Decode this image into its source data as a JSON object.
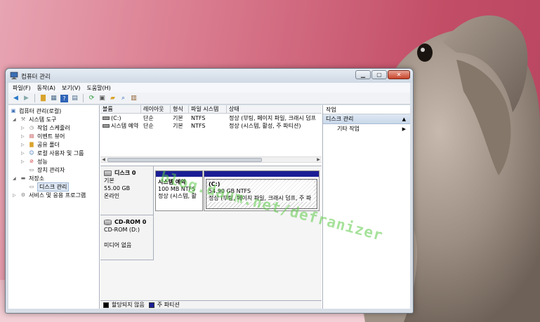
{
  "window": {
    "title": "컴퓨터 관리"
  },
  "menu": [
    "파일(F)",
    "동작(A)",
    "보기(V)",
    "도움말(H)"
  ],
  "toolbar_icons": [
    "back-arrow-icon",
    "forward-arrow-icon",
    "up-folder-icon",
    "console-tree-icon",
    "help-icon",
    "view-icon",
    "refresh-icon",
    "connect-icon",
    "open-icon",
    "search-icon",
    "properties-icon"
  ],
  "tree": {
    "root": "컴퓨터 관리(로컬)",
    "system_tools": "시스템 도구",
    "task_scheduler": "작업 스케줄러",
    "event_viewer": "이벤트 뷰어",
    "shared_folders": "공유 폴더",
    "local_users": "로컬 사용자 및 그룹",
    "performance": "성능",
    "device_manager": "장치 관리자",
    "storage": "저장소",
    "disk_management": "디스크 관리",
    "services": "서비스 및 응용 프로그램"
  },
  "volumes": {
    "headers": [
      "볼륨",
      "레이아웃",
      "형식",
      "파일 시스템",
      "상태"
    ],
    "rows": [
      [
        "(C:)",
        "단순",
        "기본",
        "NTFS",
        "정상 (부팅, 페이지 파일, 크래시 덤프"
      ],
      [
        "시스템 예약",
        "단순",
        "기본",
        "NTFS",
        "정상 (시스템, 활성, 주 파티션)"
      ]
    ]
  },
  "disks": [
    {
      "name": "디스크 0",
      "type": "기본",
      "size": "55.00 GB",
      "status": "온라인",
      "partitions": [
        {
          "name": "시스템 예약",
          "size": "100 MB NTFS",
          "status": "정상 (시스템, 활"
        },
        {
          "name": "(C:)",
          "size": "54.90 GB NTFS",
          "status": "정상 (부팅, 페이지 파일, 크래시 덤프, 주 파"
        }
      ]
    },
    {
      "name": "CD-ROM 0",
      "type": "CD-ROM (D:)",
      "status": "미디어 없음"
    }
  ],
  "legend": [
    {
      "label": "할당되지 않음",
      "color": "#000000"
    },
    {
      "label": "주 파티션",
      "color": "#1b1e94"
    }
  ],
  "actions": {
    "header": "작업",
    "section": "디스크 관리",
    "more": "기타 작업"
  },
  "watermark": "blog.daum.net/defranizer"
}
